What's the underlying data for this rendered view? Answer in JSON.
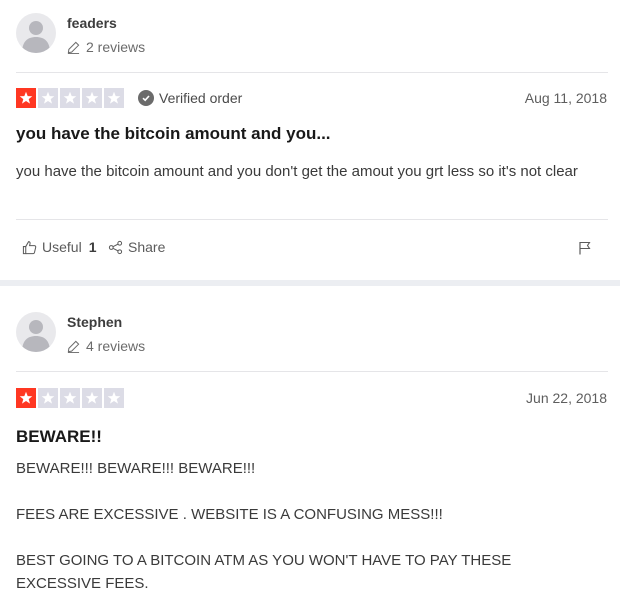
{
  "reviews": [
    {
      "reviewer": "feaders",
      "review_count": "2 reviews",
      "rating": 1,
      "max_rating": 5,
      "verified_label": "Verified order",
      "date": "Aug 11, 2018",
      "title": "you have the bitcoin amount and you...",
      "body": [
        "you have the bitcoin amount and you don't get the amout you grt less so it's not clear"
      ],
      "useful_label": "Useful",
      "useful_count": "1",
      "share_label": "Share"
    },
    {
      "reviewer": "Stephen",
      "review_count": "4 reviews",
      "rating": 1,
      "max_rating": 5,
      "date": "Jun 22, 2018",
      "title": "BEWARE!!",
      "body": [
        "BEWARE!!! BEWARE!!! BEWARE!!!",
        "FEES ARE EXCESSIVE . WEBSITE IS A CONFUSING MESS!!!",
        "BEST GOING TO A BITCOIN ATM AS YOU WON'T HAVE TO PAY THESE EXCESSIVE FEES."
      ]
    }
  ],
  "colors": {
    "star_filled": "#ff3722",
    "star_empty": "#dcdce6",
    "separator": "#eceef2"
  },
  "icons": [
    "user-avatar-icon",
    "pencil-icon",
    "star-icon",
    "check-circle-icon",
    "thumbs-up-icon",
    "share-icon",
    "flag-icon"
  ]
}
